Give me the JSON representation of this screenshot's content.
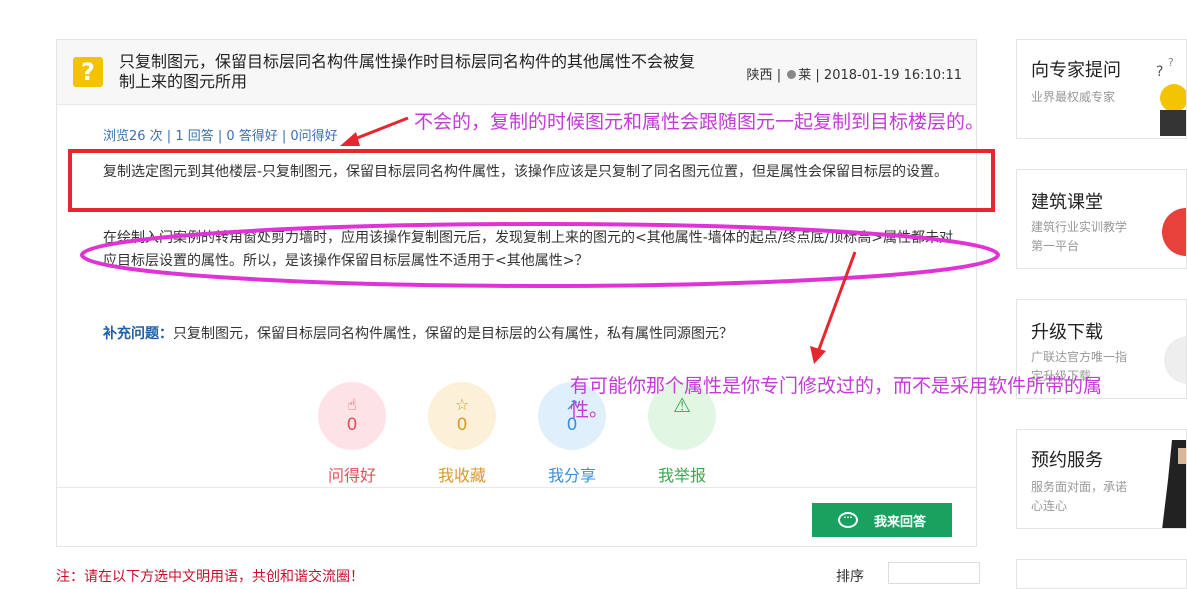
{
  "question": {
    "title": "只复制图元，保留目标层同名构件属性操作时目标层同名构件的其他属性不会被复制上来的图元所用",
    "meta": {
      "region": "陕西",
      "separator": "|",
      "user": "莱",
      "datetime": "2018-01-19 16:10:11"
    },
    "stats": "浏览26 次 | 1 回答 | 0 答得好 | 0问得好",
    "paragraph1": "复制选定图元到其他楼层-只复制图元，保留目标层同名构件属性，该操作应该是只复制了同名图元位置，但是属性会保留目标层的设置。",
    "paragraph2": "在绘制入门案例的转角窗处剪力墙时，应用该操作复制图元后，发现复制上来的图元的<其他属性-墙体的起点/终点底/顶标高>属性都未对应目标层设置的属性。所以，是该操作保留目标层属性不适用于<其他属性>？",
    "supplement_label": "补充问题：",
    "supplement_text": "只复制图元，保留目标层同名构件属性，保留的是目标层的公有属性，私有属性同源图元？"
  },
  "actions": [
    {
      "label": "问得好",
      "count": "0",
      "icon": "thumbs-up-icon",
      "color": "#e0505a",
      "bg": "#fde3e6"
    },
    {
      "label": "我收藏",
      "count": "0",
      "icon": "star-icon",
      "color": "#d89a2a",
      "bg": "#fdf0d8"
    },
    {
      "label": "我分享",
      "count": "0",
      "icon": "share-icon",
      "color": "#3a8fd8",
      "bg": "#dff0fc"
    },
    {
      "label": "我举报",
      "count": "",
      "icon": "warning-icon",
      "color": "#38a84e",
      "bg": "#e2f6e4"
    }
  ],
  "answer_button": "我来回答",
  "sidebar": [
    {
      "title": "向专家提问",
      "desc": "业界最权威专家"
    },
    {
      "title": "建筑课堂",
      "desc": "建筑行业实训教学第一平台"
    },
    {
      "title": "升级下载",
      "desc": "广联达官方唯一指定升级下载"
    },
    {
      "title": "预约服务",
      "desc": "服务面对面，承诺心连心"
    }
  ],
  "annotations": {
    "note1": "不会的，复制的时候图元和属性会跟随图元一起复制到目标楼层的。",
    "note2": "有可能你那个属性是你专门修改过的，而不是采用软件所带的属性。"
  },
  "footer": {
    "notice": "注：请在以下方选中文明用语，共创和谐交流圈！",
    "sort_label": "排序"
  },
  "colors": {
    "accent_green": "#18a15f",
    "question_icon": "#f3c300",
    "annotation_red": "#e8262f",
    "annotation_magenta": "#e033d6"
  }
}
